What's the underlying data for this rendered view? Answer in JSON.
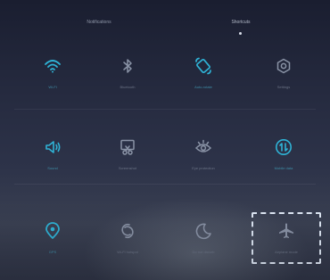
{
  "tabs": [
    {
      "label": "Notifications",
      "active": false
    },
    {
      "label": "Shortcuts",
      "active": true
    }
  ],
  "shortcuts": [
    {
      "label": "Wi-Fi",
      "icon": "wifi-icon",
      "on": true
    },
    {
      "label": "Bluetooth",
      "icon": "bluetooth-icon",
      "on": false
    },
    {
      "label": "Auto-rotate",
      "icon": "rotate-icon",
      "on": true
    },
    {
      "label": "Settings",
      "icon": "gear-icon",
      "on": false
    },
    {
      "label": "Sound",
      "icon": "sound-icon",
      "on": true
    },
    {
      "label": "Screenshot",
      "icon": "screenshot-icon",
      "on": false
    },
    {
      "label": "Eye protection",
      "icon": "eye-icon",
      "on": false
    },
    {
      "label": "Mobile data",
      "icon": "mobile-data-icon",
      "on": true
    },
    {
      "label": "GPS",
      "icon": "location-icon",
      "on": true
    },
    {
      "label": "Wi-Fi hotspot",
      "icon": "hotspot-icon",
      "on": false
    },
    {
      "label": "Do not disturb",
      "icon": "moon-icon",
      "on": false
    },
    {
      "label": "Airplane mode",
      "icon": "airplane-icon",
      "on": false
    }
  ],
  "colors": {
    "active": "#2fb3d6",
    "inactive": "#8a93a6",
    "highlight": "#dfe8f5"
  }
}
